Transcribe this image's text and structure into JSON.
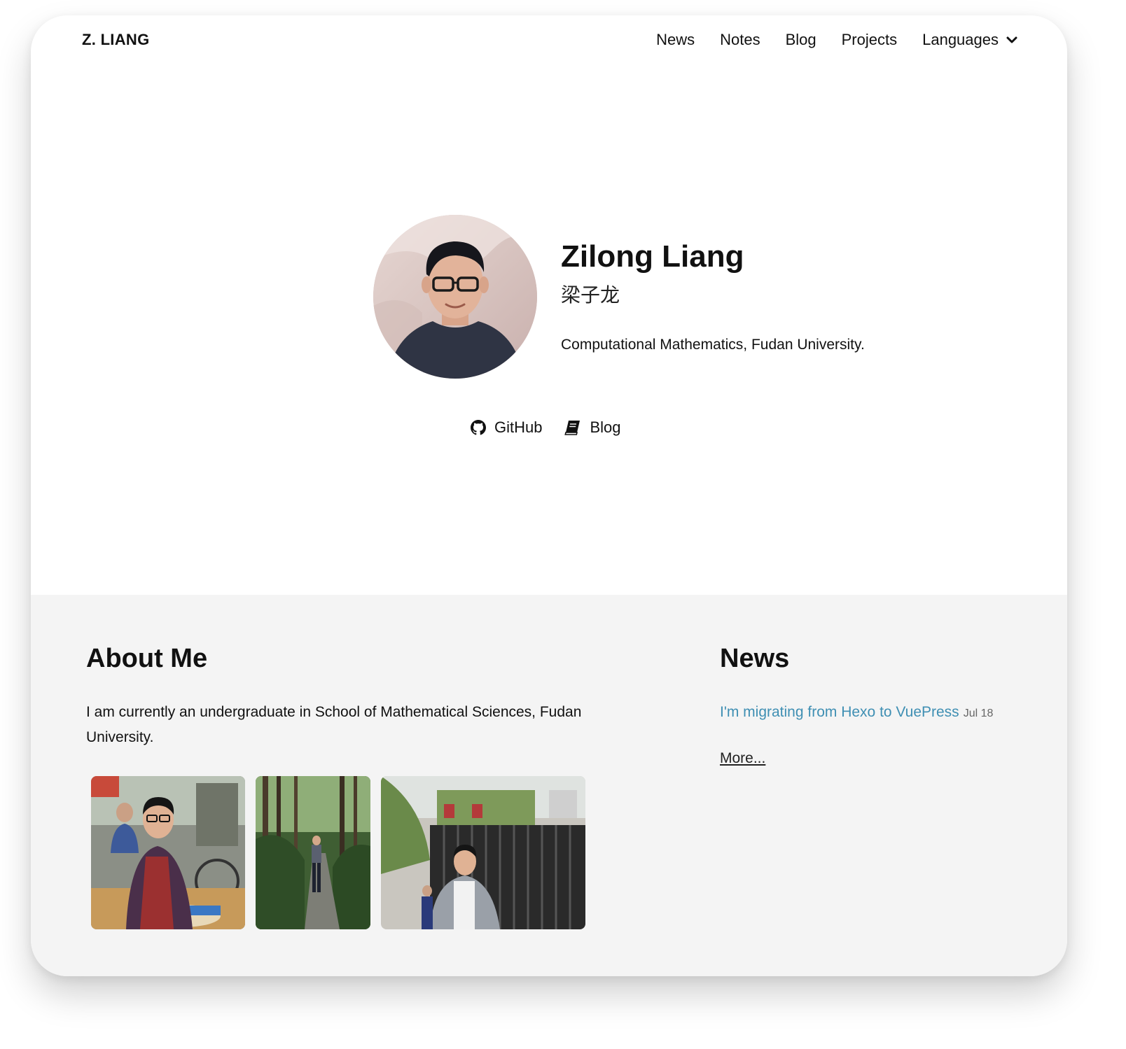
{
  "brand": "Z. LIANG",
  "nav": {
    "items": [
      {
        "label": "News"
      },
      {
        "label": "Notes"
      },
      {
        "label": "Blog"
      },
      {
        "label": "Projects"
      }
    ],
    "languages_label": "Languages"
  },
  "hero": {
    "name": "Zilong Liang",
    "name_cn": "梁子龙",
    "description": "Computational Mathematics, Fudan University.",
    "links": {
      "github_label": "GitHub",
      "blog_label": "Blog"
    }
  },
  "about": {
    "title": "About Me",
    "text": "I am currently an undergraduate in School of Mathematical Sciences, Fudan University."
  },
  "news": {
    "title": "News",
    "items": [
      {
        "title": "I'm migrating from Hexo to VuePress",
        "date": "Jul 18"
      }
    ],
    "more_label": "More..."
  },
  "colors": {
    "link": "#3f8fb3",
    "section_bg": "#f4f4f4"
  }
}
